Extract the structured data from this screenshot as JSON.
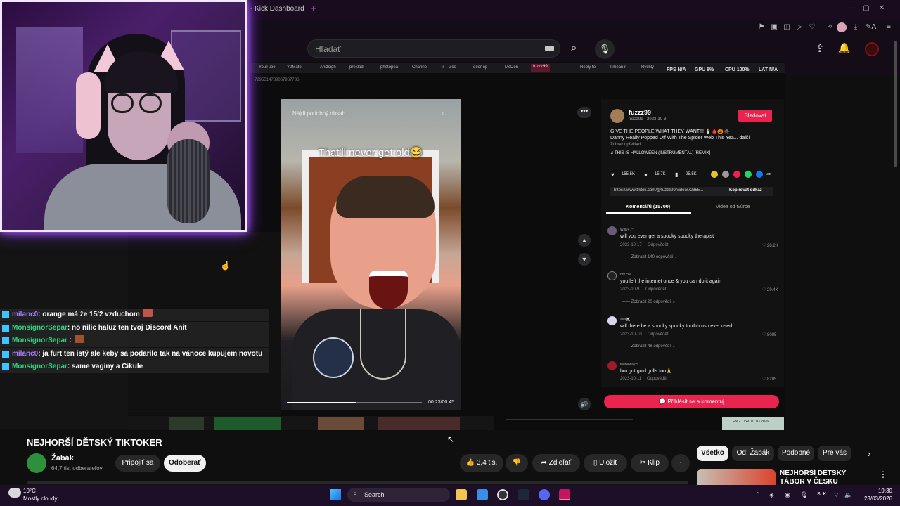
{
  "browser": {
    "tab_title": "- Kick Dashboard",
    "new_tab": "+"
  },
  "youtube_header": {
    "search_placeholder": "Hľadať",
    "search_icon": "search-icon",
    "mic_icon": "mic-icon",
    "upload_icon": "upload-icon",
    "bell_icon": "bell-icon"
  },
  "inner_screen": {
    "bookmarks": [
      "YouTube",
      "Y2Mate",
      "Anizsigh",
      "preklad",
      "photopea",
      "Channe",
      "is - Goo",
      "door op",
      "McDon",
      "fuzzz99",
      "Reply to",
      "I mean it",
      "Rychlý"
    ],
    "active_tab": "fuzzz99",
    "url": "7295514789067967786",
    "stats": {
      "fps_label": "FPS",
      "fps_value": "N/A",
      "gpu_label": "GPU",
      "gpu_value": "8%",
      "cpu_label": "CPU",
      "cpu_value": "100%",
      "lat_label": "LAT",
      "lat_value": "N/A"
    },
    "video": {
      "find_similar": "Nájdi podobný obsah",
      "caption": "That'll never get old😂",
      "time": "00:23/00:45",
      "progress": 0.51
    },
    "post": {
      "author": "fuzzz99",
      "author_sub": "fuzzz99 · 2023-10-3",
      "follow": "Sledovat",
      "desc_line1": "GIVE THE PEOPLE WHAT THEY WANT!!! 🕯️🩸🎃🕷️",
      "desc_line2": "Danny Really Popped Off With The Spider Web This Yea...  další",
      "translate": "Zobrazit překlad",
      "music": "♫ THIS IS HALLOWEEN (INSTRUMENTAL) [REMIX]",
      "likes": "155.5K",
      "comments_count": "15.7K",
      "saves": "25.5K",
      "link": "https://www.tiktok.com/@fuzzz99/video/72855...",
      "copy_link": "Kopírovat odkaz",
      "tab_comments": "Komentářů (15700)",
      "tab_videos": "Videa od tvůrce",
      "login_comment": "Přihlásit se a komentuj"
    },
    "comments": [
      {
        "user": "Willy+.*°",
        "text": "will you ever get a spooky spooky therapist",
        "date": "2023-10-17",
        "reply": "Odpovědět",
        "likes": "28.2K",
        "replies": "Zobrazit 140 odpovědí"
      },
      {
        "user": "not col",
        "text": "you left the internet once & you can do it again",
        "date": "2023-10-9",
        "reply": "Odpovědět",
        "likes": "29.4K",
        "replies": "Zobrazit 20 odpovědí"
      },
      {
        "user": "ava☠️",
        "text": "will there be a spooky spooky toothbrush ever used",
        "date": "2023-10-10",
        "reply": "Odpovědět",
        "likes": "8085",
        "replies": "Zobrazit 48 odpovědí"
      },
      {
        "user": "teehawayzz",
        "text": "bro got gold grills too🙏",
        "date": "2023-10-11",
        "reply": "Odpovědět",
        "likes": "8205"
      }
    ],
    "tray": {
      "lang": "ENG",
      "time": "17:40",
      "date": "01.03.2026"
    }
  },
  "chat": [
    {
      "user": "milanc0",
      "color": "#a77bff",
      "msg": ": orange má že 15/2 vzduchom",
      "emote": "#c0564a"
    },
    {
      "user": "MonsignorSepar",
      "color": "#35d07f",
      "msg": ": no nilic haluz ten tvoj Discord Anit",
      "emote": ""
    },
    {
      "user": "MonsignorSepar",
      "color": "#35d07f",
      "msg": " :",
      "emote": "#a0522d"
    },
    {
      "user": "milanc0",
      "color": "#a77bff",
      "msg": ": ja furt ten istý ale keby sa podarilo tak na vánoce kupujem novotu",
      "emote": ""
    },
    {
      "user": "MonsignorSepar",
      "color": "#35d07f",
      "msg": ": same vaginy a Cikule",
      "emote": ""
    }
  ],
  "video_info": {
    "title": "NEJHORŠÍ DĚTSKÝ TIKTOKER",
    "channel": "Žabák",
    "subscribers": "64,7 tis. odberateľov",
    "join": "Pripojiť sa",
    "subscribe": "Odoberať",
    "likes": "3,4 tis.",
    "share": "Zdieľať",
    "save": "Uložiť",
    "clip": "Klip",
    "more": "⋮"
  },
  "chips": {
    "all": "Všetko",
    "from": "Od: Žabák",
    "related": "Podobné",
    "for_you": "Pre vás"
  },
  "recommendation": {
    "title": "NEJHORŠÍ DĚTSKÝ TÁBOR V ČESKU"
  },
  "taskbar": {
    "temp": "10°C",
    "weather": "Mostly cloudy",
    "search": "Search",
    "lang": "SLK",
    "time": "19:30",
    "date": "23/03/2026"
  }
}
